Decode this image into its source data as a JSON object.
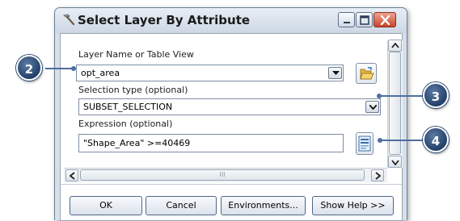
{
  "window": {
    "title": "Select Layer By Attribute",
    "title_icon": "hammer-icon",
    "controls": [
      "minimize-icon",
      "maximize-icon",
      "close-icon"
    ]
  },
  "fields": {
    "layer": {
      "label": "Layer Name or Table View",
      "value": "opt_area",
      "icon": "open-folder-icon"
    },
    "selection_type": {
      "label": "Selection type (optional)",
      "value": "SUBSET_SELECTION"
    },
    "expression": {
      "label": "Expression (optional)",
      "value": "\"Shape_Area\" >=40469",
      "icon": "sql-icon"
    }
  },
  "buttons": {
    "ok": "OK",
    "cancel": "Cancel",
    "environments": "Environments...",
    "show_help": "Show Help >>"
  },
  "scrollbar": {
    "grip": "III"
  },
  "callouts": [
    "2",
    "3",
    "4"
  ],
  "colors": {
    "callout_fill": "#2d4d7a",
    "callout_line": "#4f6ea0",
    "close_button": "#c9452c",
    "dialog_bg": "#d7dfe9"
  }
}
